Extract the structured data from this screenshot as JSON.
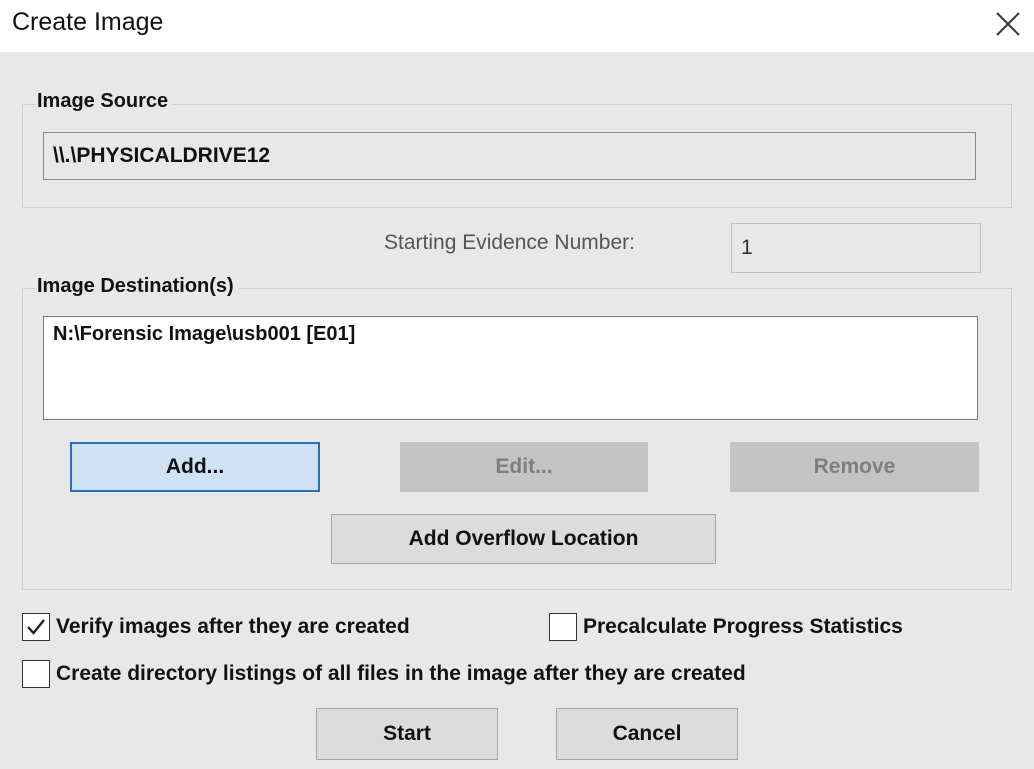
{
  "window": {
    "title": "Create Image",
    "close_glyph": "✕"
  },
  "image_source": {
    "group_label": "Image Source",
    "value": "\\\\.\\PHYSICALDRIVE12"
  },
  "evidence": {
    "label": "Starting Evidence Number:",
    "value": "1"
  },
  "image_destinations": {
    "group_label": "Image Destination(s)",
    "items": [
      "N:\\Forensic Image\\usb001 [E01]"
    ]
  },
  "buttons": {
    "add": "Add...",
    "edit": "Edit...",
    "remove": "Remove",
    "add_overflow": "Add Overflow Location",
    "start": "Start",
    "cancel": "Cancel"
  },
  "options": {
    "verify": {
      "label": "Verify images after they are created",
      "checked": true
    },
    "precalculate": {
      "label": "Precalculate Progress Statistics",
      "checked": false
    },
    "directory_listings": {
      "label": "Create directory listings of all files in the image after they are created",
      "checked": false
    }
  },
  "colors": {
    "dialog_bg": "#e8e8e8",
    "primary_border": "#2a6fbe",
    "primary_bg": "#cde2f4"
  }
}
